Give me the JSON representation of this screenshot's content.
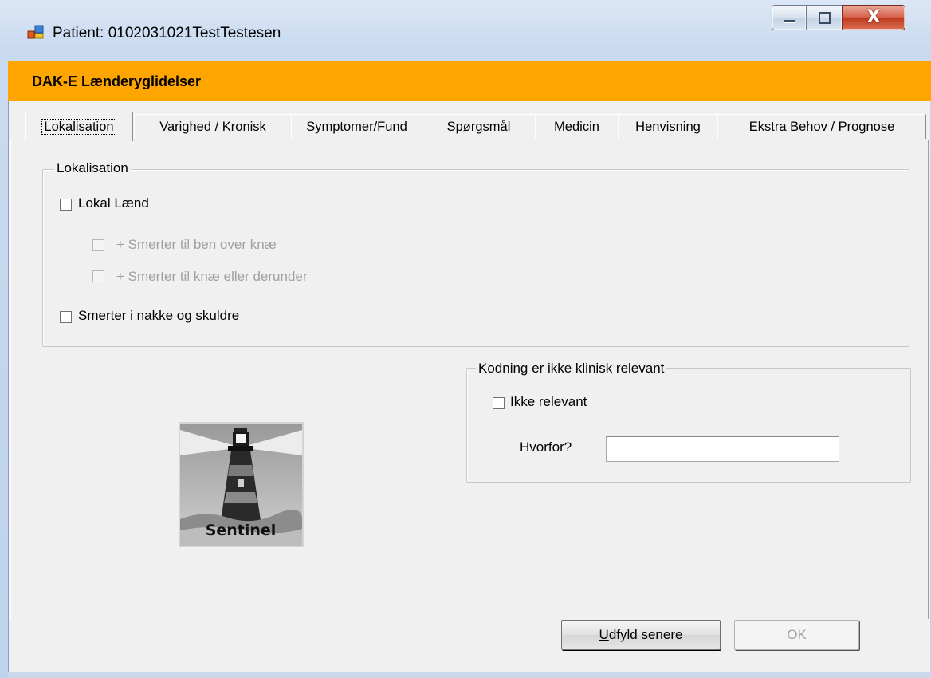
{
  "window": {
    "title": "Patient: 0102031021TestTestesen",
    "buttons": {
      "minimize": "minimize",
      "maximize": "maximize",
      "close": "X"
    }
  },
  "header": {
    "title": "DAK-E Lænderyglidelser",
    "band_color": "#ffa500"
  },
  "tabs": [
    {
      "label": "Lokalisation",
      "active": true
    },
    {
      "label": "Varighed / Kronisk",
      "active": false
    },
    {
      "label": "Symptomer/Fund",
      "active": false
    },
    {
      "label": "Spørgsmål",
      "active": false
    },
    {
      "label": "Medicin",
      "active": false
    },
    {
      "label": "Henvisning",
      "active": false
    },
    {
      "label": "Ekstra Behov / Prognose",
      "active": false
    }
  ],
  "lokalisation_group": {
    "legend": "Lokalisation",
    "options": [
      {
        "label": "Lokal Lænd",
        "checked": false,
        "enabled": true
      },
      {
        "label": "+ Smerter til ben over knæ",
        "checked": false,
        "enabled": false
      },
      {
        "label": "+ Smerter til knæ eller derunder",
        "checked": false,
        "enabled": false
      },
      {
        "label": "Smerter i nakke og skuldre",
        "checked": false,
        "enabled": true
      }
    ]
  },
  "kodning_group": {
    "legend": "Kodning er ikke klinisk relevant",
    "ikke_relevant": {
      "label": "Ikke relevant",
      "checked": false
    },
    "hvorfor": {
      "label": "Hvorfor?",
      "value": ""
    }
  },
  "logo": {
    "text": "Sentinel",
    "icon": "lighthouse-icon"
  },
  "footer": {
    "later_button": {
      "mnemonic": "U",
      "rest": "dfyld senere"
    },
    "ok_button": {
      "label": "OK",
      "enabled": false
    }
  }
}
